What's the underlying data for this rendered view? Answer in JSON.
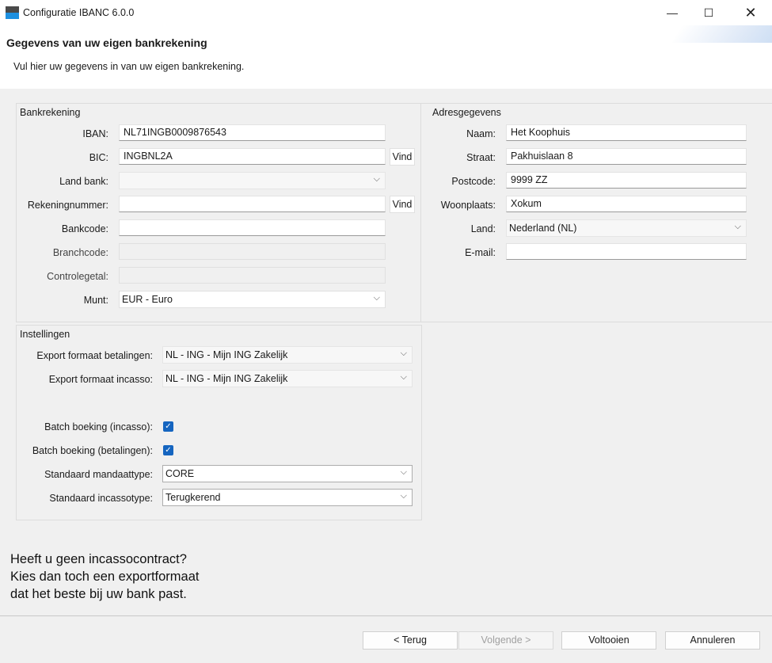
{
  "window": {
    "title": "Configuratie IBANC 6.0.0",
    "minimize_glyph": "—",
    "maximize_glyph": "☐",
    "close_glyph": "✕"
  },
  "header": {
    "title": "Gegevens van uw eigen bankrekening",
    "subtitle": "Vul hier uw gegevens in van uw eigen bankrekening."
  },
  "bank": {
    "group_title": "Bankrekening",
    "iban_label": "IBAN:",
    "iban_value": "NL71INGB0009876543",
    "bic_label": "BIC:",
    "bic_value": "INGBNL2A",
    "bic_find": "Vind",
    "land_label": "Land bank:",
    "land_value": "",
    "account_label": "Rekeningnummer:",
    "account_value": "",
    "account_find": "Vind",
    "bankcode_label": "Bankcode:",
    "bankcode_value": "",
    "branchcode_label": "Branchcode:",
    "branchcode_value": "",
    "control_label": "Controlegetal:",
    "control_value": "",
    "currency_label": "Munt:",
    "currency_value": "EUR - Euro"
  },
  "address": {
    "group_title": "Adresgegevens",
    "name_label": "Naam:",
    "name_value": "Het Koophuis",
    "street_label": "Straat:",
    "street_value": "Pakhuislaan 8",
    "postcode_label": "Postcode:",
    "postcode_value": "9999 ZZ",
    "city_label": "Woonplaats:",
    "city_value": "Xokum",
    "country_label": "Land:",
    "country_value": "Nederland (NL)",
    "email_label": "E-mail:",
    "email_value": ""
  },
  "settings": {
    "group_title": "Instellingen",
    "export_pay_label": "Export formaat betalingen:",
    "export_pay_value": "NL - ING - Mijn ING Zakelijk",
    "export_coll_label": "Export formaat incasso:",
    "export_coll_value": "NL - ING - Mijn ING Zakelijk",
    "batch_coll_label": "Batch boeking (incasso):",
    "batch_coll_checked": true,
    "batch_pay_label": "Batch boeking (betalingen):",
    "batch_pay_checked": true,
    "mandate_label": "Standaard mandaattype:",
    "mandate_value": "CORE",
    "coll_type_label": "Standaard incassotype:",
    "coll_type_value": "Terugkerend"
  },
  "help_text": {
    "line1": "Heeft u geen incassocontract?",
    "line2": "Kies dan toch een exportformaat",
    "line3": "dat het beste bij uw bank past."
  },
  "footer": {
    "back": "< Terug",
    "next": "Volgende >",
    "finish": "Voltooien",
    "cancel": "Annuleren"
  },
  "colors": {
    "accent": "#1565c0",
    "background": "#f0f0f0"
  }
}
